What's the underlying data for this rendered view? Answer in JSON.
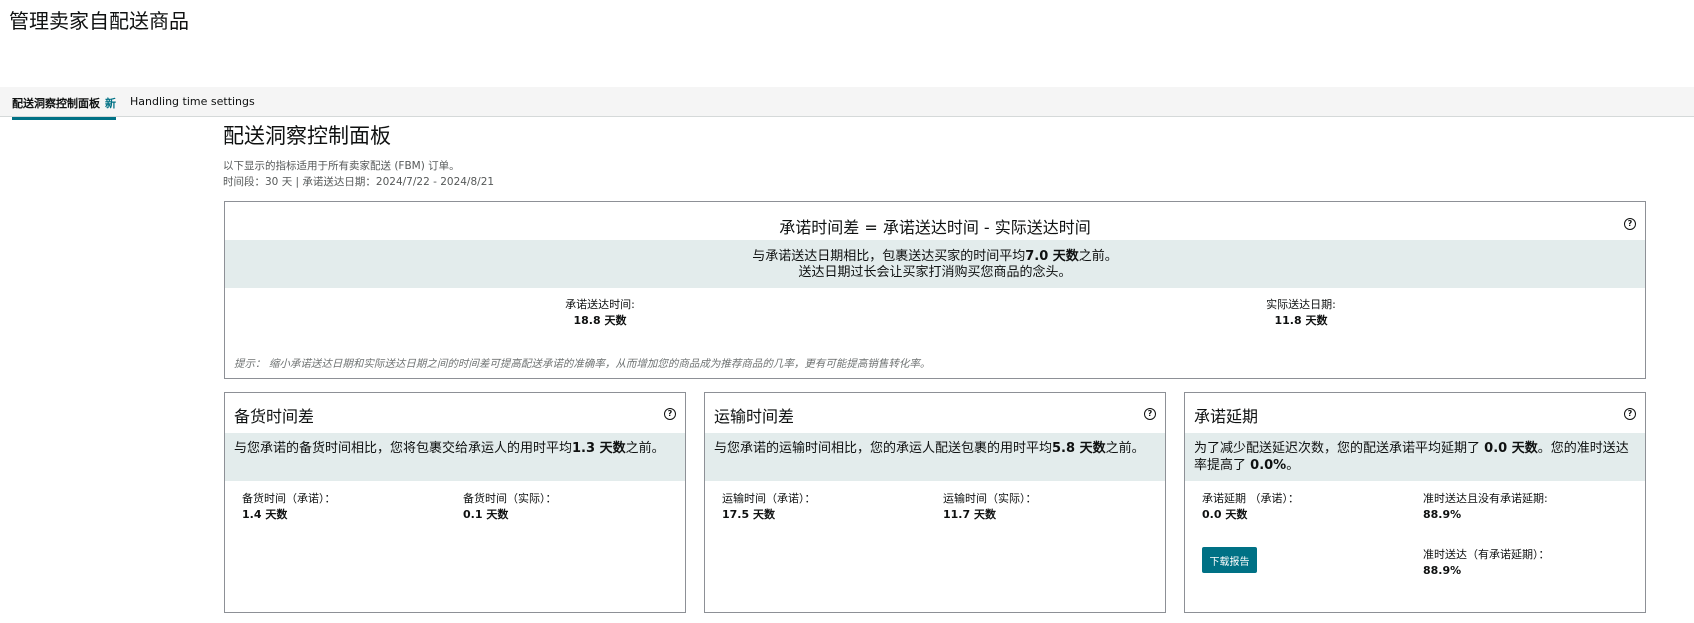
{
  "page_title": "管理卖家自配送商品",
  "tabs": [
    {
      "label": "配送洞察控制面板",
      "badge": "新"
    },
    {
      "label": "Handling time settings"
    }
  ],
  "dashboard": {
    "title": "配送洞察控制面板",
    "desc_line1": "以下显示的指标适用于所有卖家配送 (FBM) 订单。",
    "desc_line2": "时间段：30 天 | 承诺送达日期：2024/7/22 - 2024/8/21"
  },
  "summary": {
    "title": "承诺时间差 = 承诺送达时间 - 实际送达时间",
    "band_prefix": "与承诺送达日期相比，包裹送达买家的时间平均",
    "band_value": "7.0 天数",
    "band_suffix": "之前。",
    "band_line2": "送达日期过长会让买家打消购买您商品的念头。",
    "promised_label": "承诺送达时间:",
    "promised_value": "18.8 天数",
    "actual_label": "实际送达日期:",
    "actual_value": "11.8 天数",
    "hint": "提示： 缩小承诺送达日期和实际送达日期之间的时间差可提高配送承诺的准确率，从而增加您的商品成为推荐商品的几率，更有可能提高销售转化率。"
  },
  "handling": {
    "title": "备货时间差",
    "band_prefix": "与您承诺的备货时间相比，您将包裹交给承运人的用时平均",
    "band_value": "1.3 天数",
    "band_suffix": "之前。",
    "promised_label": "备货时间（承诺）：",
    "promised_value": "1.4 天数",
    "actual_label": "备货时间（实际）：",
    "actual_value": "0.1 天数"
  },
  "transit": {
    "title": "运输时间差",
    "band_prefix": "与您承诺的运输时间相比，您的承运人配送包裹的用时平均",
    "band_value": "5.8 天数",
    "band_suffix": "之前。",
    "promised_label": "运输时间（承诺）：",
    "promised_value": "17.5 天数",
    "actual_label": "运输时间（实际）：",
    "actual_value": "11.7 天数"
  },
  "extension": {
    "title": "承诺延期",
    "band_prefix": "为了减少配送延迟次数，您的配送承诺平均延期了",
    "band_value": "0.0 天数",
    "band_mid": "。您的准时送达率提高了",
    "band_value2": "0.0%",
    "band_suffix": "。",
    "promised_label": "承诺延期 （承诺）：",
    "promised_value": "0.0 天数",
    "ontime_no_ext_label": "准时送达且没有承诺延期:",
    "ontime_no_ext_value": "88.9%",
    "ontime_ext_label": "准时送达（有承诺延期）：",
    "ontime_ext_value": "88.9%",
    "download_label": "下载报告"
  },
  "colors": {
    "accent": "#007185",
    "band": "#e3ecec",
    "border": "#8d9096"
  }
}
